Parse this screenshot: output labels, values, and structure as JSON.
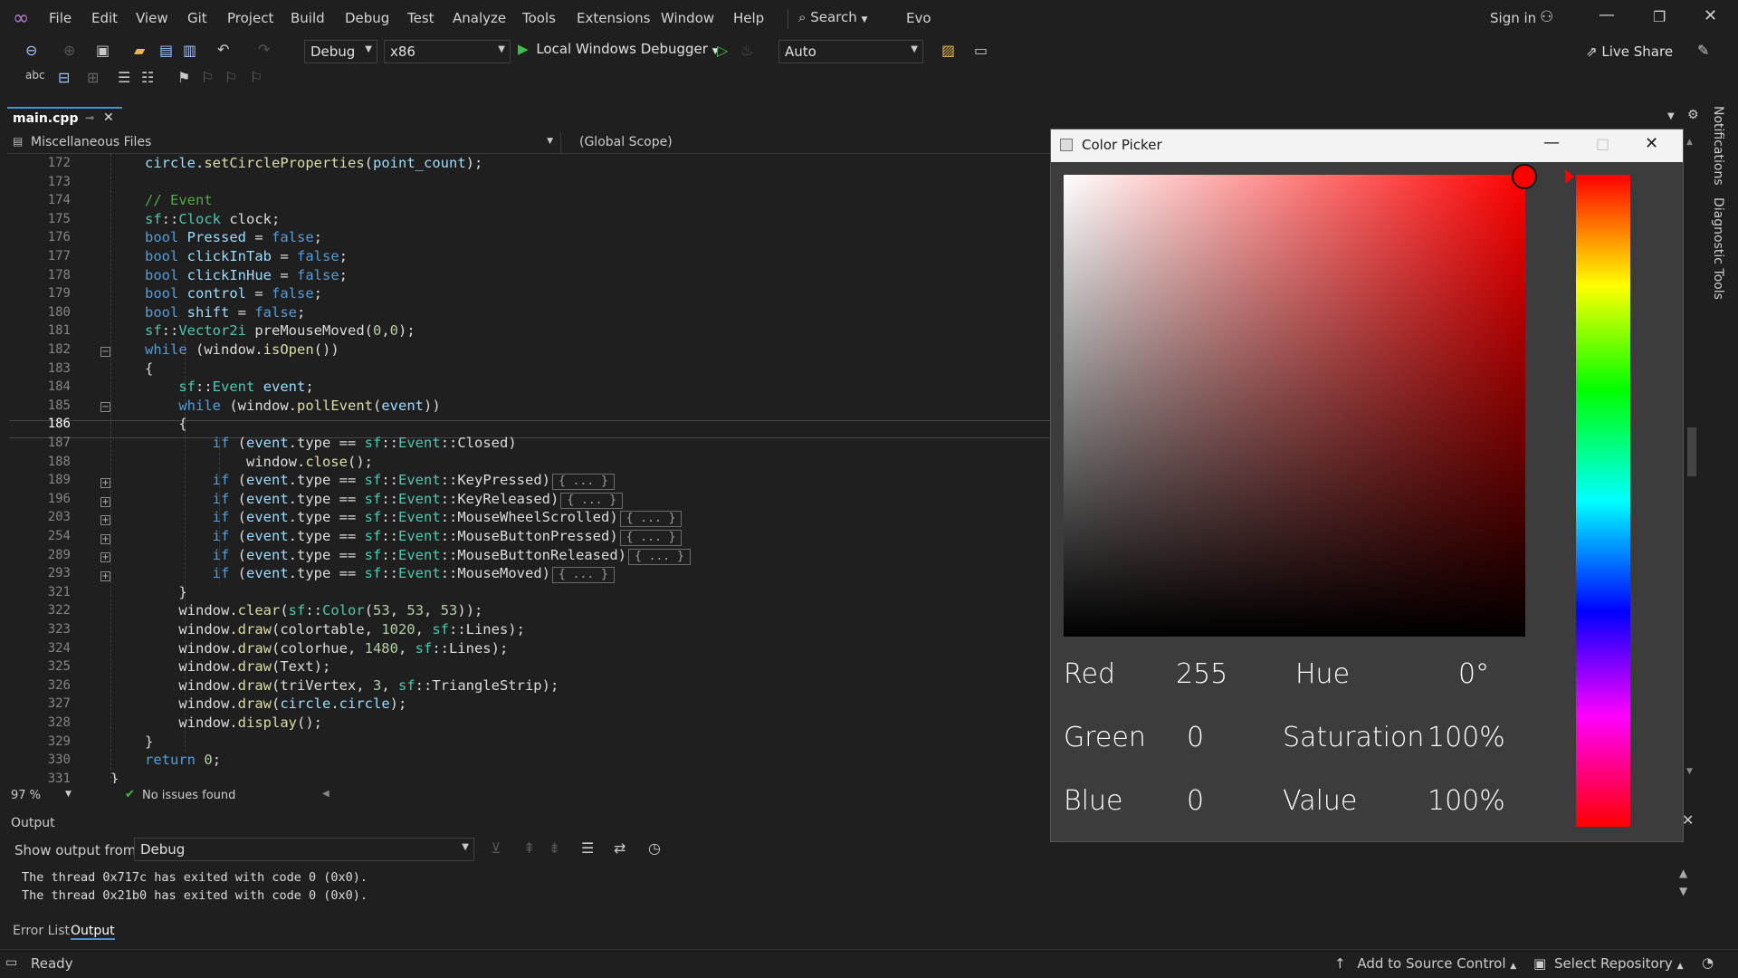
{
  "titlebar": {
    "menus": [
      "File",
      "Edit",
      "View",
      "Git",
      "Project",
      "Build",
      "Debug",
      "Test",
      "Analyze",
      "Tools",
      "Extensions",
      "Window",
      "Help"
    ],
    "search": "Search",
    "solution": "Evo",
    "sign_in": "Sign in"
  },
  "toolbar": {
    "config": "Debug",
    "platform": "x86",
    "debugger": "Local Windows Debugger",
    "auto": "Auto",
    "live_share": "Live Share"
  },
  "tab": {
    "label": "main.cpp"
  },
  "nav": {
    "project": "Miscellaneous Files",
    "scope": "(Global Scope)"
  },
  "editor": {
    "line_numbers": [
      "172",
      "173",
      "174",
      "175",
      "176",
      "177",
      "178",
      "179",
      "180",
      "181",
      "182",
      "183",
      "184",
      "185",
      "186",
      "187",
      "188",
      "189",
      "196",
      "203",
      "254",
      "289",
      "293",
      "321",
      "322",
      "323",
      "324",
      "325",
      "326",
      "327",
      "328",
      "329",
      "330",
      "331"
    ]
  },
  "status": {
    "zoom": "97 %",
    "issues": "No issues found"
  },
  "output": {
    "title": "Output",
    "show_from_label": "Show output from:",
    "source": "Debug",
    "lines": [
      "The thread 0x717c has exited with code 0 (0x0).",
      "The thread 0x21b0 has exited with code 0 (0x0)."
    ]
  },
  "bottom_tabs": [
    "Error List",
    "Output"
  ],
  "statusbar": {
    "ready": "Ready",
    "source_control": "Add to Source Control",
    "repo": "Select Repository"
  },
  "right_rail": {
    "notifications": "Notifications",
    "diagnostic": "Diagnostic Tools"
  },
  "picker": {
    "title": "Color Picker",
    "red_label": "Red",
    "red": "255",
    "green_label": "Green",
    "green": "0",
    "blue_label": "Blue",
    "blue": "0",
    "hue_label": "Hue",
    "hue": "0°",
    "sat_label": "Saturation",
    "sat": "100%",
    "val_label": "Value",
    "val": "100%"
  },
  "colors": {
    "accent": "#4f8ddb",
    "background": "#1f1f1f",
    "keyword": "#569cd6",
    "type": "#4ec9b0"
  }
}
